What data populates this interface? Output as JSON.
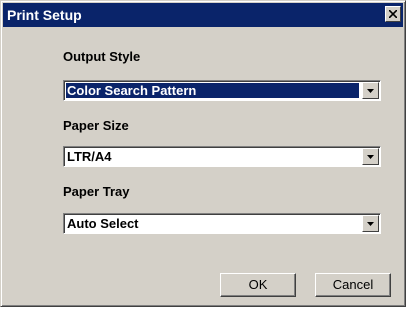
{
  "window": {
    "title": "Print Setup",
    "close_icon": "close-x-icon"
  },
  "fields": {
    "output_style": {
      "label": "Output Style",
      "value": "Color Search Pattern",
      "focused": true
    },
    "paper_size": {
      "label": "Paper Size",
      "value": "LTR/A4"
    },
    "paper_tray": {
      "label": "Paper Tray",
      "value": "Auto Select"
    }
  },
  "buttons": {
    "ok_label": "OK",
    "cancel_label": "Cancel"
  },
  "colors": {
    "titlebar": "#0a246a",
    "face": "#d4d0c8",
    "selection": "#0a246a"
  }
}
